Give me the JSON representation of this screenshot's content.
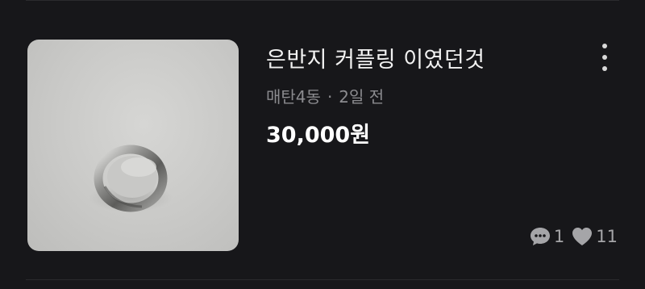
{
  "listing": {
    "title": "은반지 커플링 이였던것",
    "location": "매탄4동",
    "separator": "·",
    "time_ago": "2일 전",
    "price": "30,000원",
    "comments_count": "1",
    "likes_count": "11",
    "thumbnail_icon": "silver-ring-photo"
  },
  "menu": {
    "icon": "more-vertical-icon"
  },
  "colors": {
    "background": "#17171a",
    "title": "#f2f2f2",
    "meta": "#8b8b8f",
    "price": "#ffffff",
    "stats": "#a5a5a8"
  }
}
